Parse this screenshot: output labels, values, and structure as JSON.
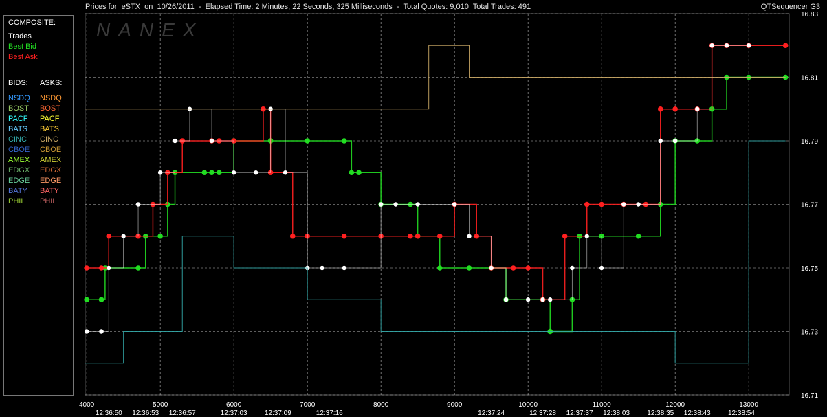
{
  "header": {
    "title": "Prices for  eSTX  on  10/26/2011  -  Elapsed Time: 2 Minutes, 22 Seconds, 325 Milliseconds  -  Total Quotes: 9,010  Total Trades: 491",
    "app_name": "QTSequencer G3",
    "watermark": "NANEX"
  },
  "legend": {
    "composite_label": "COMPOSITE:",
    "composite_items": [
      {
        "label": "Trades",
        "color": "#ffffff"
      },
      {
        "label": "Best Bid",
        "color": "#22dd22"
      },
      {
        "label": "Best Ask",
        "color": "#ff2020"
      }
    ],
    "bids_label": "BIDS:",
    "asks_label": "ASKS:",
    "exchanges": [
      {
        "bid": "NSDQ",
        "ask": "NSDQ",
        "bid_color": "#3399ff",
        "ask_color": "#ff9933"
      },
      {
        "bid": "BOST",
        "ask": "BOST",
        "bid_color": "#99cc66",
        "ask_color": "#ff6633"
      },
      {
        "bid": "PACF",
        "ask": "PACF",
        "bid_color": "#33ffff",
        "ask_color": "#ffff33"
      },
      {
        "bid": "BATS",
        "ask": "BATS",
        "bid_color": "#66ccff",
        "ask_color": "#ffcc33"
      },
      {
        "bid": "CINC",
        "ask": "CINC",
        "bid_color": "#33aaaa",
        "ask_color": "#ccaa66"
      },
      {
        "bid": "CBOE",
        "ask": "CBOE",
        "bid_color": "#3366cc",
        "ask_color": "#cc9933"
      },
      {
        "bid": "AMEX",
        "ask": "AMEX",
        "bid_color": "#99ff33",
        "ask_color": "#cccc33"
      },
      {
        "bid": "EDGX",
        "ask": "EDGX",
        "bid_color": "#66aa66",
        "ask_color": "#cc6633"
      },
      {
        "bid": "EDGE",
        "ask": "EDGE",
        "bid_color": "#66cc99",
        "ask_color": "#ff9966"
      },
      {
        "bid": "BATY",
        "ask": "BATY",
        "bid_color": "#5577dd",
        "ask_color": "#ff6666"
      },
      {
        "bid": "PHIL",
        "ask": "PHIL",
        "bid_color": "#99cc33",
        "ask_color": "#cc6666"
      }
    ]
  },
  "chart_data": {
    "type": "line",
    "title": "Prices for eSTX on 10/26/2011",
    "x_axis": {
      "label": "",
      "range": [
        3980,
        13550
      ],
      "ticks": [
        4000,
        5000,
        6000,
        7000,
        8000,
        9000,
        10000,
        11000,
        12000,
        13000
      ]
    },
    "y_axis": {
      "label": "",
      "range": [
        16.71,
        16.83
      ],
      "ticks": [
        16.71,
        16.73,
        16.75,
        16.77,
        16.79,
        16.81,
        16.83
      ]
    },
    "time_labels": [
      {
        "x": 4300,
        "label": "12:36:50"
      },
      {
        "x": 4800,
        "label": "12:36:53"
      },
      {
        "x": 5300,
        "label": "12:36:57"
      },
      {
        "x": 6000,
        "label": "12:37:03"
      },
      {
        "x": 6600,
        "label": "12:37:09"
      },
      {
        "x": 7300,
        "label": "12:37:16"
      },
      {
        "x": 9500,
        "label": "12:37:24"
      },
      {
        "x": 10200,
        "label": "12:37:28"
      },
      {
        "x": 10700,
        "label": "12:37:37"
      },
      {
        "x": 11200,
        "label": "12:38:03"
      },
      {
        "x": 11800,
        "label": "12:38:35"
      },
      {
        "x": 12300,
        "label": "12:38:43"
      },
      {
        "x": 12900,
        "label": "12:38:54"
      }
    ],
    "grid": true,
    "series": [
      {
        "name": "Best Bid",
        "color": "#22dd22",
        "points": [
          [
            4000,
            16.74
          ],
          [
            4200,
            16.74
          ],
          [
            4250,
            16.75
          ],
          [
            4700,
            16.75
          ],
          [
            4800,
            16.76
          ],
          [
            5000,
            16.76
          ],
          [
            5100,
            16.77
          ],
          [
            5200,
            16.78
          ],
          [
            5600,
            16.78
          ],
          [
            5700,
            16.78
          ],
          [
            5800,
            16.78
          ],
          [
            6000,
            16.79
          ],
          [
            6500,
            16.79
          ],
          [
            7000,
            16.79
          ],
          [
            7500,
            16.79
          ],
          [
            7600,
            16.78
          ],
          [
            7700,
            16.78
          ],
          [
            8000,
            16.77
          ],
          [
            8400,
            16.77
          ],
          [
            8500,
            16.76
          ],
          [
            8800,
            16.75
          ],
          [
            9200,
            16.75
          ],
          [
            9500,
            16.75
          ],
          [
            9700,
            16.74
          ],
          [
            10200,
            16.74
          ],
          [
            10300,
            16.73
          ],
          [
            10600,
            16.74
          ],
          [
            10700,
            16.76
          ],
          [
            11000,
            16.76
          ],
          [
            11500,
            16.76
          ],
          [
            11800,
            16.77
          ],
          [
            12000,
            16.79
          ],
          [
            12300,
            16.79
          ],
          [
            12500,
            16.8
          ],
          [
            12700,
            16.81
          ],
          [
            13000,
            16.81
          ],
          [
            13500,
            16.81
          ]
        ]
      },
      {
        "name": "Best Ask",
        "color": "#ff2020",
        "points": [
          [
            4000,
            16.75
          ],
          [
            4200,
            16.75
          ],
          [
            4300,
            16.76
          ],
          [
            4700,
            16.76
          ],
          [
            4900,
            16.77
          ],
          [
            5100,
            16.78
          ],
          [
            5300,
            16.79
          ],
          [
            5700,
            16.79
          ],
          [
            5800,
            16.79
          ],
          [
            6000,
            16.79
          ],
          [
            6400,
            16.8
          ],
          [
            6500,
            16.78
          ],
          [
            6800,
            16.76
          ],
          [
            7000,
            16.76
          ],
          [
            7500,
            16.76
          ],
          [
            8000,
            16.76
          ],
          [
            8400,
            16.76
          ],
          [
            8500,
            16.76
          ],
          [
            8800,
            16.76
          ],
          [
            9000,
            16.77
          ],
          [
            9300,
            16.76
          ],
          [
            9500,
            16.75
          ],
          [
            9800,
            16.75
          ],
          [
            10000,
            16.75
          ],
          [
            10200,
            16.74
          ],
          [
            10500,
            16.76
          ],
          [
            10800,
            16.77
          ],
          [
            11000,
            16.77
          ],
          [
            11300,
            16.77
          ],
          [
            11600,
            16.77
          ],
          [
            11800,
            16.8
          ],
          [
            12000,
            16.8
          ],
          [
            12300,
            16.8
          ],
          [
            12500,
            16.82
          ],
          [
            12700,
            16.82
          ],
          [
            13000,
            16.82
          ],
          [
            13500,
            16.82
          ]
        ]
      },
      {
        "name": "Trades",
        "color": "#ffffff",
        "points": [
          [
            4000,
            16.73
          ],
          [
            4200,
            16.73
          ],
          [
            4300,
            16.75
          ],
          [
            4500,
            16.76
          ],
          [
            4700,
            16.77
          ],
          [
            5000,
            16.78
          ],
          [
            5200,
            16.79
          ],
          [
            5400,
            16.8
          ],
          [
            5700,
            16.79
          ],
          [
            6000,
            16.78
          ],
          [
            6300,
            16.78
          ],
          [
            6500,
            16.8
          ],
          [
            6700,
            16.78
          ],
          [
            7000,
            16.75
          ],
          [
            7200,
            16.75
          ],
          [
            7500,
            16.75
          ],
          [
            8000,
            16.77
          ],
          [
            8200,
            16.77
          ],
          [
            8500,
            16.77
          ],
          [
            9000,
            16.77
          ],
          [
            9200,
            16.76
          ],
          [
            9500,
            16.75
          ],
          [
            9700,
            16.74
          ],
          [
            10000,
            16.74
          ],
          [
            10200,
            16.74
          ],
          [
            10300,
            16.74
          ],
          [
            10600,
            16.75
          ],
          [
            10800,
            16.76
          ],
          [
            11000,
            16.75
          ],
          [
            11300,
            16.77
          ],
          [
            11500,
            16.77
          ],
          [
            11800,
            16.79
          ],
          [
            12000,
            16.79
          ],
          [
            12300,
            16.8
          ],
          [
            12500,
            16.82
          ],
          [
            12700,
            16.82
          ],
          [
            13000,
            16.82
          ]
        ]
      },
      {
        "name": "CINC",
        "color": "#33aaaa",
        "points": [
          [
            3980,
            16.72
          ],
          [
            4100,
            16.72
          ],
          [
            4500,
            16.73
          ],
          [
            5000,
            16.73
          ],
          [
            5300,
            16.76
          ],
          [
            6000,
            16.75
          ],
          [
            7000,
            16.74
          ],
          [
            8000,
            16.73
          ],
          [
            9000,
            16.73
          ],
          [
            10000,
            16.73
          ],
          [
            10600,
            16.73
          ],
          [
            11000,
            16.73
          ],
          [
            12000,
            16.72
          ],
          [
            13000,
            16.79
          ],
          [
            13500,
            16.79
          ]
        ]
      },
      {
        "name": "CINC",
        "color": "#ccaa66",
        "points": [
          [
            3980,
            16.8
          ],
          [
            4800,
            16.8
          ],
          [
            5000,
            16.8
          ],
          [
            6000,
            16.8
          ],
          [
            8000,
            16.8
          ],
          [
            8500,
            16.8
          ],
          [
            8650,
            16.82
          ],
          [
            9100,
            16.82
          ],
          [
            9200,
            16.81
          ],
          [
            11000,
            16.81
          ],
          [
            12500,
            16.81
          ],
          [
            13500,
            16.81
          ]
        ]
      }
    ]
  }
}
